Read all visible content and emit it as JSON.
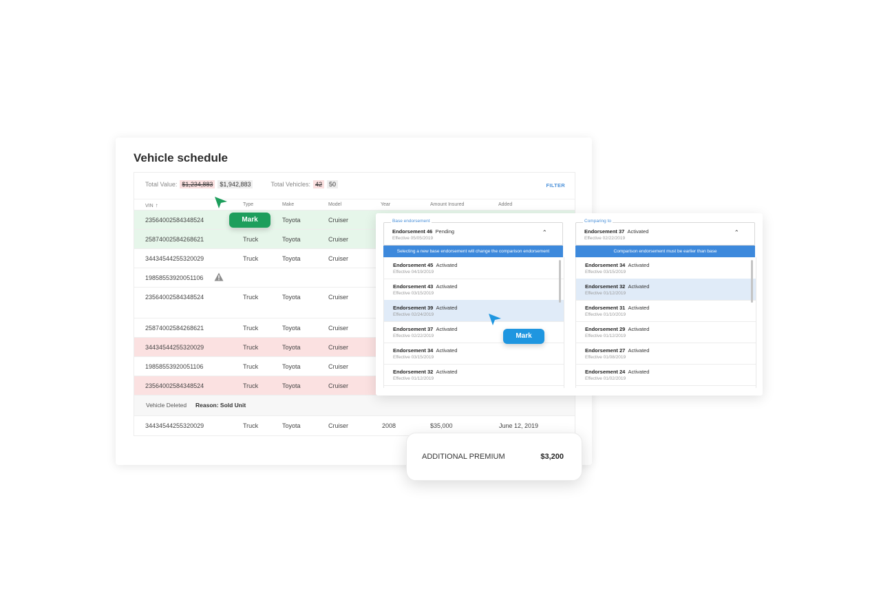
{
  "page": {
    "title": "Vehicle schedule"
  },
  "summary": {
    "total_value_label": "Total Value:",
    "total_value_old": "$1,234,883",
    "total_value_new": "$1,942,883",
    "total_vehicles_label": "Total Vehicles:",
    "total_vehicles_old": "42",
    "total_vehicles_new": "50",
    "filter_label": "FILTER"
  },
  "table": {
    "columns": [
      "VIN",
      "Type",
      "Make",
      "Model",
      "Year",
      "Amount Insured",
      "Added"
    ],
    "sort_icon": "arrow-up-icon",
    "rows": [
      {
        "vin": "23564002584348524",
        "type": "",
        "make": "Toyota",
        "model": "Cruiser",
        "year": "",
        "amount": "",
        "added": "",
        "status": "added"
      },
      {
        "vin": "25874002584268621",
        "type": "Truck",
        "make": "Toyota",
        "model": "Cruiser",
        "year": "",
        "amount": "",
        "added": "",
        "status": "added"
      },
      {
        "vin": "34434544255320029",
        "type": "Truck",
        "make": "Toyota",
        "model": "Cruiser",
        "year": "",
        "amount": "",
        "added": "",
        "status": "normal"
      },
      {
        "vin": "19858553920051106",
        "type": "",
        "make": "",
        "model": "",
        "year": "",
        "amount": "",
        "added": "",
        "status": "warning"
      },
      {
        "vin": "23564002584348524",
        "type": "Truck",
        "make": "Toyota",
        "model": "Cruiser",
        "year": "",
        "amount": "",
        "added": "",
        "status": "normal"
      },
      {
        "vin": "25874002584268621",
        "type": "Truck",
        "make": "Toyota",
        "model": "Cruiser",
        "year": "",
        "amount": "",
        "added": "",
        "status": "normal"
      },
      {
        "vin": "34434544255320029",
        "type": "Truck",
        "make": "Toyota",
        "model": "Cruiser",
        "year": "",
        "amount": "",
        "added": "",
        "status": "removed"
      },
      {
        "vin": "19858553920051106",
        "type": "Truck",
        "make": "Toyota",
        "model": "Cruiser",
        "year": "",
        "amount": "",
        "added": "",
        "status": "normal"
      },
      {
        "vin": "23564002584348524",
        "type": "Truck",
        "make": "Toyota",
        "model": "Cruiser",
        "year": "",
        "amount": "",
        "added": "",
        "status": "removed"
      },
      {
        "vin": "34434544255320029",
        "type": "Truck",
        "make": "Toyota",
        "model": "Cruiser",
        "year": "2008",
        "amount": "$35,000",
        "added": "June 12, 2019",
        "status": "normal"
      }
    ],
    "deleted_row": {
      "label": "Vehicle Deleted",
      "reason": "Reason: Sold Unit"
    }
  },
  "mark_label": "Mark",
  "endorsements": {
    "base": {
      "legend": "Base endorsement",
      "selected_name": "Endorsement 46",
      "selected_status": "Pending",
      "selected_effective": "Effective 05/05/2019",
      "info": "Selecting a new base endorsement will change the comparison endorsement",
      "items": [
        {
          "name": "Endorsement 45",
          "status": "Activated",
          "effective": "Effective 04/19/2019"
        },
        {
          "name": "Endorsement 43",
          "status": "Activated",
          "effective": "Effective 03/15/2019"
        },
        {
          "name": "Endorsement 39",
          "status": "Activated",
          "effective": "Effective 02/24/2019"
        },
        {
          "name": "Endorsement 37",
          "status": "Activated",
          "effective": "Effective 02/22/2019"
        },
        {
          "name": "Endorsement 34",
          "status": "Activated",
          "effective": "Effective 03/15/2019"
        },
        {
          "name": "Endorsement 32",
          "status": "Activated",
          "effective": "Effective 01/12/2019"
        }
      ]
    },
    "compare": {
      "legend": "Comparing to",
      "selected_name": "Endorsement 37",
      "selected_status": "Activated",
      "selected_effective": "Effective 02/22/2019",
      "info": "Comparison endorsement must be earlier than base",
      "items": [
        {
          "name": "Endorsement 34",
          "status": "Activated",
          "effective": "Effective 03/15/2019"
        },
        {
          "name": "Endorsement 32",
          "status": "Activated",
          "effective": "Effective 01/12/2019"
        },
        {
          "name": "Endorsement 31",
          "status": "Activated",
          "effective": "Effective 01/10/2019"
        },
        {
          "name": "Endorsement 29",
          "status": "Activated",
          "effective": "Effective 01/12/2019"
        },
        {
          "name": "Endorsement 27",
          "status": "Activated",
          "effective": "Effective 01/08/2019"
        },
        {
          "name": "Endorsement 24",
          "status": "Activated",
          "effective": "Effective 01/02/2019"
        }
      ]
    }
  },
  "premium": {
    "label": "ADDITIONAL PREMIUM",
    "value": "$3,200"
  },
  "colors": {
    "added_row": "#e6f6ea",
    "removed_row": "#fbe1e1",
    "accent_blue": "#3d89dc",
    "mark_green": "#1d9e5c",
    "mark_blue": "#1f96e0"
  }
}
